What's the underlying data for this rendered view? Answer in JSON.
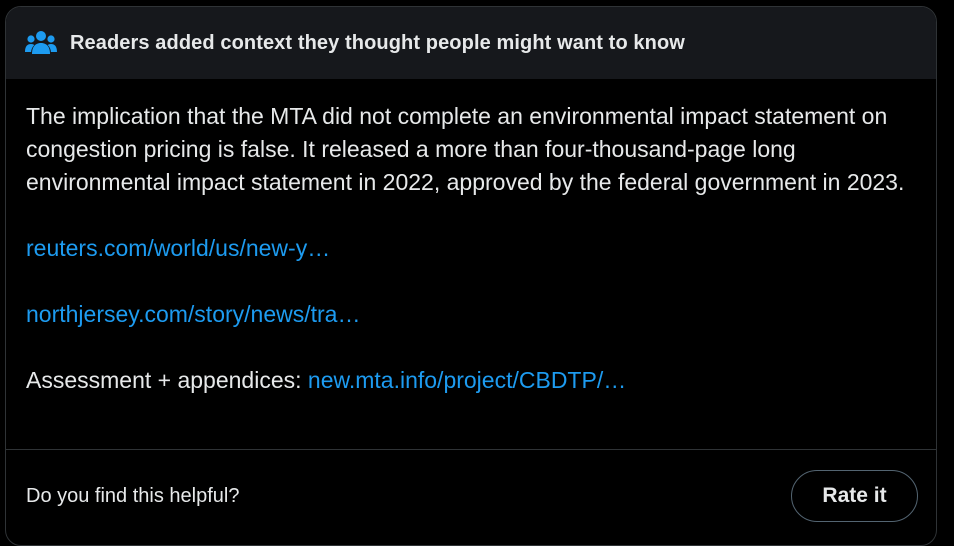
{
  "header": {
    "icon": "people-group-icon",
    "title": "Readers added context they thought people might want to know",
    "icon_color": "#1d9bf0"
  },
  "note": {
    "text": "The implication that the MTA did not complete an environmental impact statement on congestion pricing is false. It released a more than four-thousand-page long environmental impact statement in 2022, approved by the federal government in 2023.",
    "links": [
      "reuters.com/world/us/new-y…",
      "northjersey.com/story/news/tra…"
    ],
    "assessment_label": "Assessment + appendices: ",
    "assessment_link": "new.mta.info/project/CBDTP/…"
  },
  "footer": {
    "question": "Do you find this helpful?",
    "rate_button_label": "Rate it"
  },
  "colors": {
    "link": "#1d9bf0",
    "text": "#e7e9ea",
    "header_bg": "#16181c",
    "border": "#2f3336"
  }
}
